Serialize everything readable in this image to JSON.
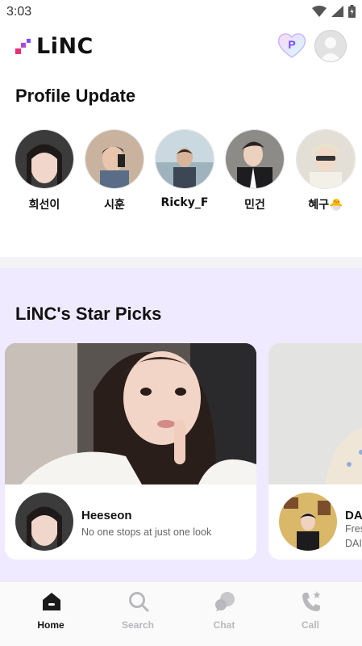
{
  "status_bar": {
    "time": "3:03"
  },
  "header": {
    "logo_text": "LiNC",
    "points_label": "P"
  },
  "profile_update": {
    "title": "Profile Update",
    "profiles": [
      {
        "name": "희선이"
      },
      {
        "name": "시훈"
      },
      {
        "name": "Ricky_F"
      },
      {
        "name": "민건"
      },
      {
        "name": "혜구🐣"
      }
    ]
  },
  "star_picks": {
    "title": "LiNC's Star Picks",
    "cards": [
      {
        "name": "Heeseon",
        "description": "No one stops at just one look"
      },
      {
        "name": "DA",
        "description": "Fres",
        "description2": "DAI"
      }
    ]
  },
  "bottom_nav": {
    "items": [
      {
        "label": "Home",
        "icon": "home-icon",
        "active": true
      },
      {
        "label": "Search",
        "icon": "search-icon",
        "active": false
      },
      {
        "label": "Chat",
        "icon": "chat-icon",
        "active": false
      },
      {
        "label": "Call",
        "icon": "call-icon",
        "active": false
      }
    ]
  },
  "colors": {
    "brand_pink": "#e8307a",
    "brand_purple": "#7b4bff",
    "star_section_bg": "#efeaff",
    "nav_active": "#111111",
    "nav_inactive": "#b8b8be"
  }
}
